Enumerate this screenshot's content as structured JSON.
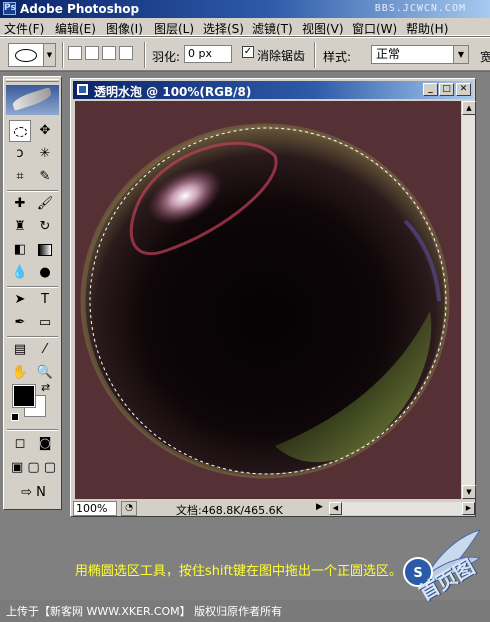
{
  "app": {
    "title": "Adobe Photoshop",
    "watermark": "BBS.JCWCN.COM"
  },
  "menu": [
    "文件(F)",
    "编辑(E)",
    "图像(I)",
    "图层(L)",
    "选择(S)",
    "滤镜(T)",
    "视图(V)",
    "窗口(W)",
    "帮助(H)"
  ],
  "options": {
    "feather_label": "羽化:",
    "feather_value": "0 px",
    "antialias_checked": true,
    "antialias_label": "消除锯齿",
    "style_label": "样式:",
    "style_value": "正常",
    "width_label": "宽"
  },
  "document": {
    "title": "透明水泡 @ 100%(RGB/8)",
    "zoom": "100%",
    "doc_info": "文档:468.8K/465.6K",
    "canvas_color": "#553035"
  },
  "colors": {
    "foreground": "#000000",
    "background": "#ffffff"
  },
  "caption": "用椭圆选区工具，按住shift键在图中拖出一个正圆选区。",
  "footer": "上传于【新客网 WWW.XKER.COM】 版权归原作者所有",
  "badge_text": "首页图"
}
